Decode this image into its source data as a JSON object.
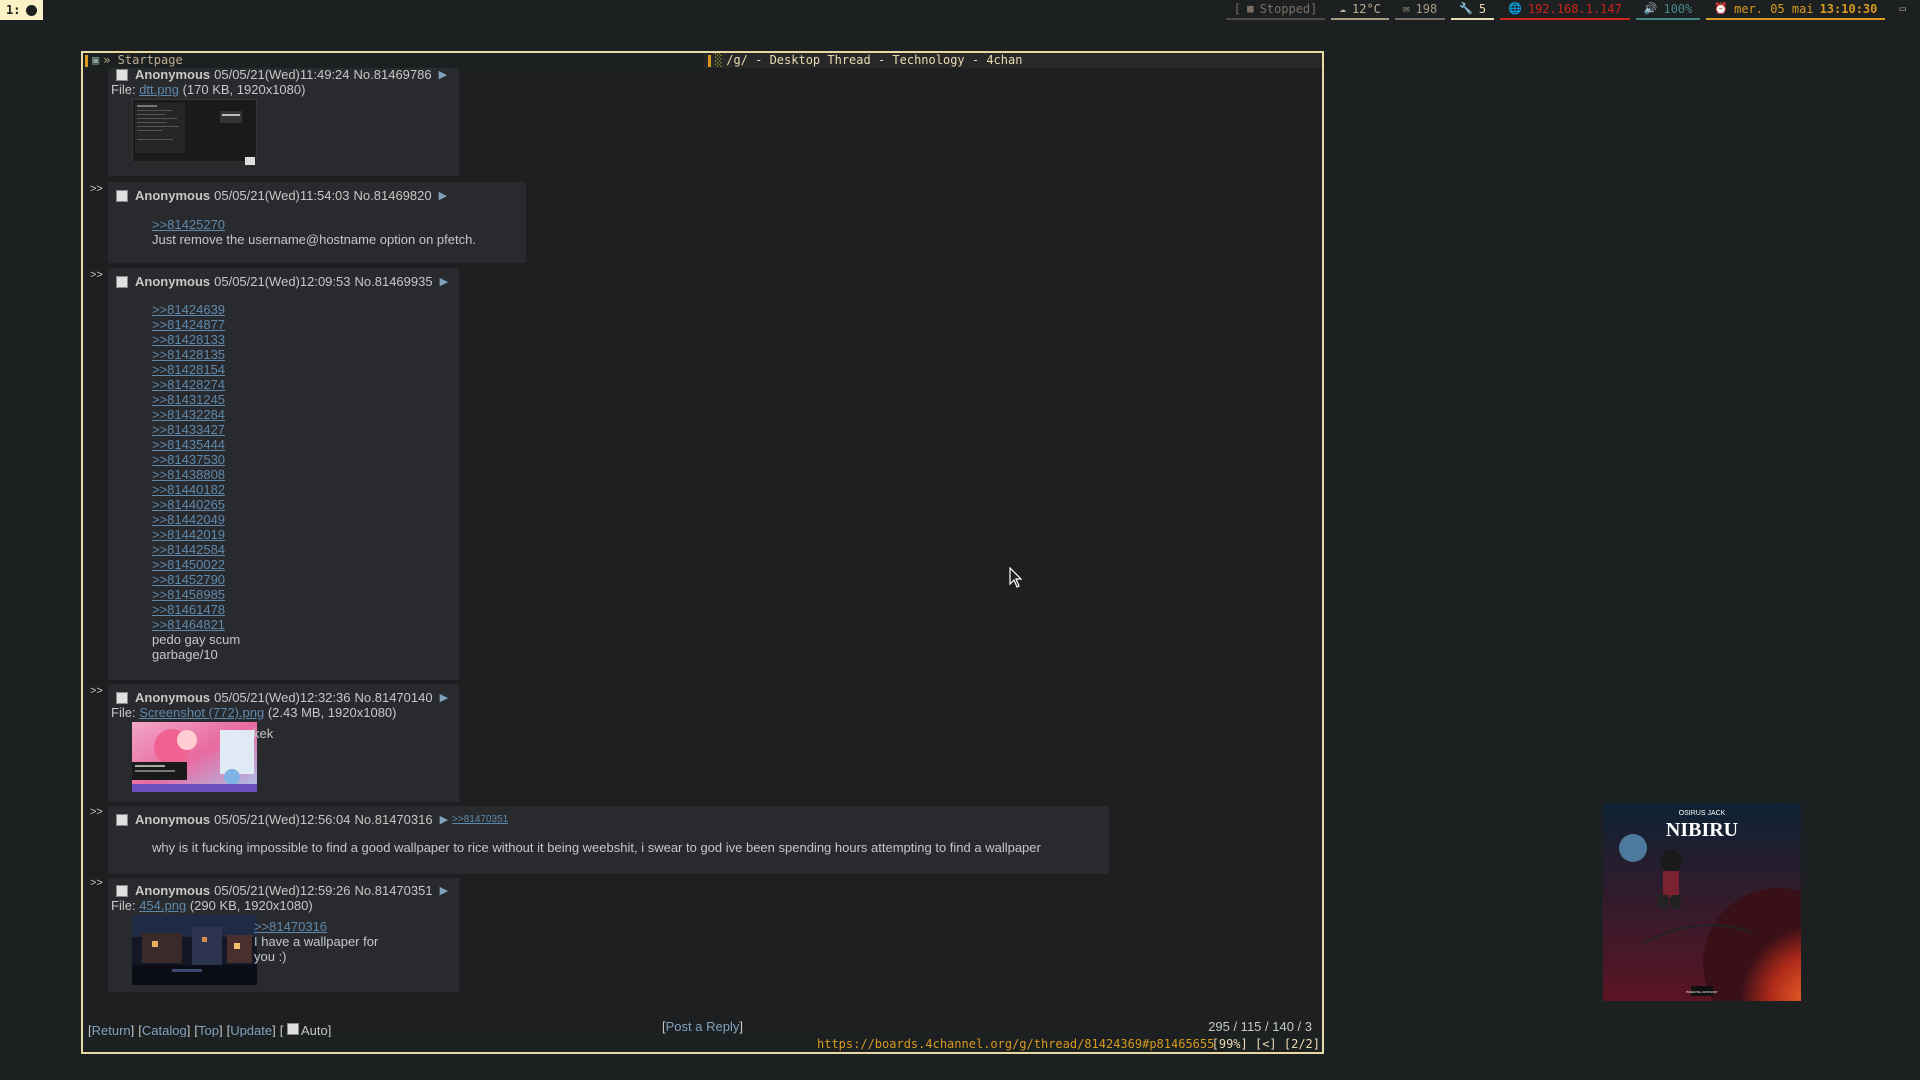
{
  "topbar": {
    "workspace": "1:",
    "blocks": [
      {
        "name": "mpd",
        "icon": "■",
        "text": "Stopped]",
        "prefix": "[",
        "color": "#7c6f64",
        "line": "#504945"
      },
      {
        "name": "weather",
        "icon": "☁",
        "text": "12°C",
        "color": "#bdae93",
        "line": "#a89984"
      },
      {
        "name": "mail",
        "icon": "✉",
        "text": "198",
        "color": "#a89984",
        "line": "#7c6f64"
      },
      {
        "name": "updates",
        "icon": "🔧",
        "text": "5",
        "color": "#ebdbb2",
        "line": "#ebdbb2"
      },
      {
        "name": "network",
        "icon": "🌐",
        "text": "192.168.1.147",
        "color": "#cc241d",
        "line": "#cc241d"
      },
      {
        "name": "volume",
        "icon": "🔊",
        "text": "100%",
        "color": "#458588",
        "line": "#458588"
      },
      {
        "name": "clock",
        "icon": "⏰",
        "text": "mer. 05 mai ",
        "bold": "13:10:30",
        "color": "#d79921",
        "line": "#d79921"
      },
      {
        "name": "tray",
        "icon": "▭",
        "text": "",
        "color": "#a89984",
        "line": "#1d2021"
      }
    ]
  },
  "tabs": {
    "tab1_label": "» Startpage",
    "tab2_label": "/g/ - Desktop Thread - Technology - 4chan"
  },
  "posts": [
    {
      "side": "",
      "name": "Anonymous",
      "datetime": "05/05/21(Wed)11:49:24",
      "no": "No.81469786",
      "file_label": "File:",
      "file_name": "dtt.png",
      "file_meta": "(170 KB, 1920x1080)",
      "lines": []
    },
    {
      "side": ">>",
      "name": "Anonymous",
      "datetime": "05/05/21(Wed)11:54:03",
      "no": "No.81469820",
      "links": ">>81425270",
      "lines": [
        "Just remove the username@hostname option on pfetch."
      ]
    },
    {
      "side": ">>",
      "name": "Anonymous",
      "datetime": "05/05/21(Wed)12:09:53",
      "no": "No.81469935",
      "quote_links": [
        ">>81424639",
        ">>81424877",
        ">>81428133",
        ">>81428135",
        ">>81428154",
        ">>81428274",
        ">>81431245",
        ">>81432284",
        ">>81433427",
        ">>81435444",
        ">>81437530",
        ">>81438808",
        ">>81440182",
        ">>81440265",
        ">>81442049",
        ">>81442019",
        ">>81442584",
        ">>81450022",
        ">>81452790",
        ">>81458985",
        ">>81461478",
        ">>81464821"
      ],
      "lines": [
        "pedo gay scum",
        "garbage/10"
      ]
    },
    {
      "side": ">>",
      "name": "Anonymous",
      "datetime": "05/05/21(Wed)12:32:36",
      "no": "No.81470140",
      "file_label": "File:",
      "file_name": "Screenshot (772).png",
      "file_meta": "(2.43 MB, 1920x1080)",
      "lines": [
        "kek"
      ]
    },
    {
      "side": ">>",
      "name": "Anonymous",
      "datetime": "05/05/21(Wed)12:56:04",
      "no": "No.81470316",
      "backlink": ">>81470351",
      "lines": [
        "why is it fucking impossible to find a good wallpaper to rice without it being weebshit, i swear to god ive been spending hours attempting to find a wallpaper"
      ]
    },
    {
      "side": ">>",
      "name": "Anonymous",
      "datetime": "05/05/21(Wed)12:59:26",
      "no": "No.81470351",
      "file_label": "File:",
      "file_name": "454.png",
      "file_meta": "(290 KB, 1920x1080)",
      "links": ">>81470316",
      "lines": [
        "I have a wallpaper for",
        "you :)"
      ]
    }
  ],
  "footer": {
    "return": "Return",
    "catalog": "Catalog",
    "top": "Top",
    "update": "Update",
    "auto": "Auto",
    "post_reply": "Post a Reply",
    "stats": "295 / 115 / 140 / 3"
  },
  "statusline": {
    "url": "https://boards.4channel.org/g/thread/81424369#p81465655",
    "rest": "[99%] [<] [2/2]"
  },
  "album": {
    "artist": "OSIRUS JACK",
    "title": "NIBIRU",
    "advisory": "PARENTAL ADVISORY"
  }
}
